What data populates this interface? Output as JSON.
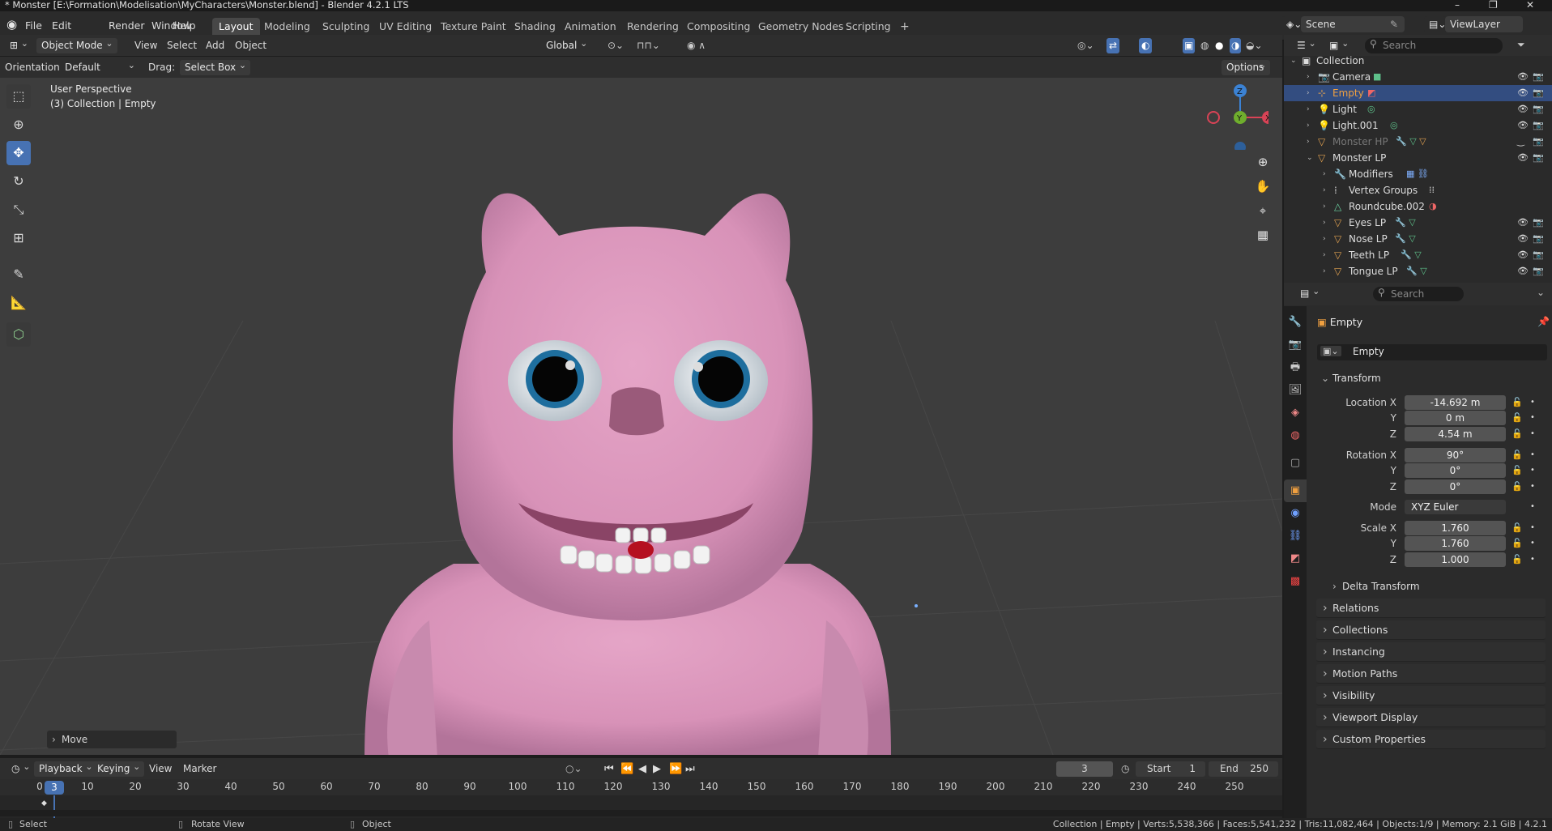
{
  "window": {
    "title": "* Monster [E:\\Formation\\Modelisation\\MyCharacters\\Monster.blend] - Blender 4.2.1 LTS",
    "controls": [
      "–",
      "❐",
      "✕"
    ]
  },
  "menu": [
    "File",
    "Edit",
    "Render",
    "Window",
    "Help"
  ],
  "workspaces": [
    "Layout",
    "Modeling",
    "Sculpting",
    "UV Editing",
    "Texture Paint",
    "Shading",
    "Animation",
    "Rendering",
    "Compositing",
    "Geometry Nodes",
    "Scripting"
  ],
  "active_workspace": "Layout",
  "scene": {
    "name": "Scene",
    "view_layer": "ViewLayer"
  },
  "viewport_header": {
    "mode": "Object Mode",
    "menus": [
      "View",
      "Select",
      "Add",
      "Object"
    ],
    "transform": "Global"
  },
  "tool_settings": {
    "orientation_label": "Orientation:",
    "orientation": "Default",
    "drag_label": "Drag:",
    "drag": "Select Box",
    "options": "Options"
  },
  "viewport": {
    "perspective": "User Perspective",
    "collection_info": "(3) Collection | Empty",
    "last_op": "Move",
    "gizmo": {
      "z": "Z",
      "y": "Y",
      "x": "X"
    }
  },
  "outliner": {
    "search_placeholder": "Search",
    "items": [
      {
        "name": "Collection",
        "type": "collection",
        "depth": 0
      },
      {
        "name": "Camera",
        "type": "camera",
        "depth": 1
      },
      {
        "name": "Empty",
        "type": "empty",
        "depth": 1,
        "selected": true
      },
      {
        "name": "Light",
        "type": "light",
        "depth": 1
      },
      {
        "name": "Light.001",
        "type": "light",
        "depth": 1
      },
      {
        "name": "Monster HP",
        "type": "mesh",
        "depth": 1,
        "dimmed": true
      },
      {
        "name": "Monster LP",
        "type": "mesh",
        "depth": 1,
        "expanded": true
      },
      {
        "name": "Modifiers",
        "type": "modifiers",
        "depth": 2
      },
      {
        "name": "Vertex Groups",
        "type": "vgroups",
        "depth": 2
      },
      {
        "name": "Roundcube.002",
        "type": "meshdata",
        "depth": 2
      },
      {
        "name": "Eyes LP",
        "type": "mesh",
        "depth": 2
      },
      {
        "name": "Nose LP",
        "type": "mesh",
        "depth": 2
      },
      {
        "name": "Teeth LP",
        "type": "mesh",
        "depth": 2
      },
      {
        "name": "Tongue LP",
        "type": "mesh",
        "depth": 2
      }
    ]
  },
  "properties": {
    "search_placeholder": "Search",
    "object_name": "Empty",
    "data_name": "Empty",
    "transform_label": "Transform",
    "location_label": "Location X",
    "location": {
      "x": "-14.692 m",
      "y": "0 m",
      "z": "4.54 m"
    },
    "rotation_label": "Rotation X",
    "rotation": {
      "x": "90°",
      "y": "0°",
      "z": "0°"
    },
    "mode_label": "Mode",
    "mode": "XYZ Euler",
    "scale_label": "Scale X",
    "scale": {
      "x": "1.760",
      "y": "1.760",
      "z": "1.000"
    },
    "axis_y": "Y",
    "axis_z": "Z",
    "delta": "Delta Transform",
    "panels": [
      "Relations",
      "Collections",
      "Instancing",
      "Motion Paths",
      "Visibility",
      "Viewport Display",
      "Custom Properties"
    ]
  },
  "timeline": {
    "menus": [
      "Playback",
      "Keying",
      "View",
      "Marker"
    ],
    "current_frame": "3",
    "start_label": "Start",
    "start": "1",
    "end_label": "End",
    "end": "250",
    "ticks": [
      "0",
      "10",
      "20",
      "30",
      "40",
      "50",
      "60",
      "70",
      "80",
      "90",
      "100",
      "110",
      "120",
      "130",
      "140",
      "150",
      "160",
      "170",
      "180",
      "190",
      "200",
      "210",
      "220",
      "230",
      "240",
      "250"
    ]
  },
  "status": {
    "select": "Select",
    "rotate": "Rotate View",
    "object": "Object",
    "info": "Collection | Empty | Verts:5,538,366 | Faces:5,541,232 | Tris:11,082,464 | Objects:1/9 | Memory: 2.1 GiB | 4.2.1"
  },
  "colors": {
    "accent": "#4772b3",
    "selected_row": "#334d80",
    "monster": "#d892b8"
  }
}
